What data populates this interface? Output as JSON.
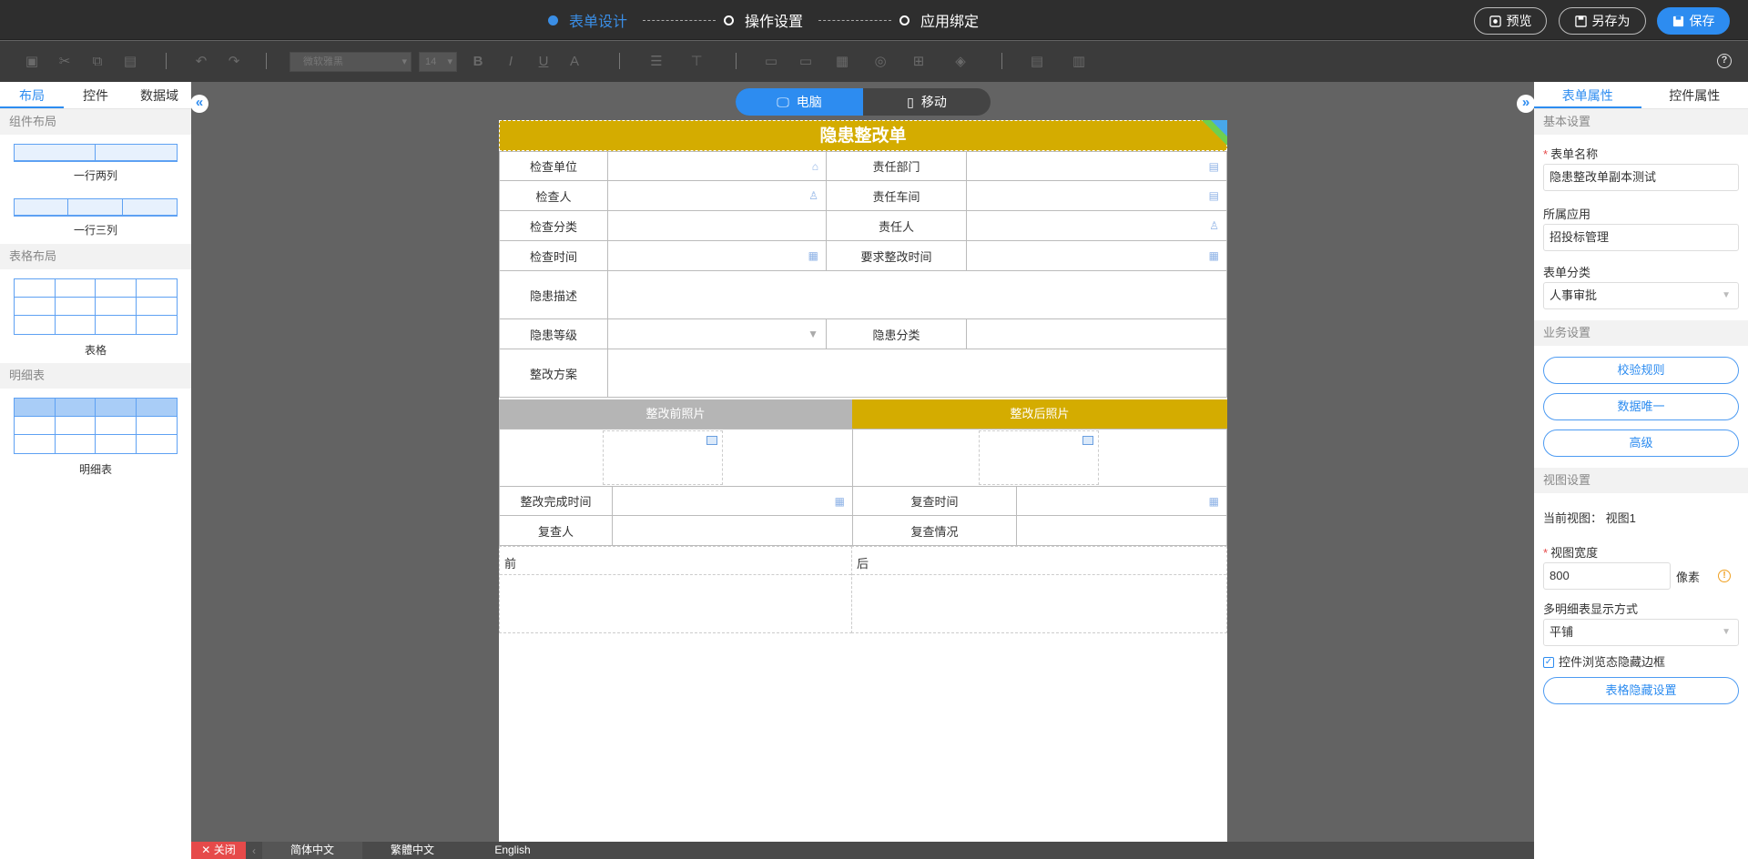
{
  "steps": [
    "表单设计",
    "操作设置",
    "应用绑定"
  ],
  "top_buttons": {
    "preview": "预览",
    "save_as": "另存为",
    "save": "保存"
  },
  "toolbar": {
    "font_name": "微软雅黑",
    "font_size": "14"
  },
  "left_panel": {
    "tabs": [
      "布局",
      "控件",
      "数据域"
    ],
    "sections": {
      "component_layout": "组件布局",
      "table_layout": "表格布局",
      "detail_table": "明细表"
    },
    "items": {
      "two_cols": "一行两列",
      "three_cols": "一行三列",
      "table": "表格",
      "detail": "明细表"
    }
  },
  "device": {
    "pc": "电脑",
    "mobile": "移动"
  },
  "form": {
    "title": "隐患整改单",
    "fields": {
      "check_unit": "检查单位",
      "resp_dept": "责任部门",
      "inspector": "检查人",
      "resp_workshop": "责任车间",
      "check_category": "检查分类",
      "resp_person": "责任人",
      "check_time": "检查时间",
      "req_fix_time": "要求整改时间",
      "hazard_desc": "隐患描述",
      "hazard_level": "隐患等级",
      "hazard_category": "隐患分类",
      "fix_plan": "整改方案",
      "photo_before": "整改前照片",
      "photo_after": "整改后照片",
      "fix_done_time": "整改完成时间",
      "recheck_time": "复查时间",
      "rechecker": "复查人",
      "recheck_status": "复查情况",
      "before": "前",
      "after": "后"
    }
  },
  "languages": {
    "close": "关闭",
    "tabs": [
      "简体中文",
      "繁體中文",
      "English"
    ]
  },
  "right_panel": {
    "tabs": [
      "表单属性",
      "控件属性"
    ],
    "basic_settings": "基本设置",
    "form_name_label": "表单名称",
    "form_name_value": "隐患整改单副本测试",
    "app_label": "所属应用",
    "app_value": "招投标管理",
    "category_label": "表单分类",
    "category_value": "人事审批",
    "business_settings": "业务设置",
    "buttons": [
      "校验规则",
      "数据唯一",
      "高级"
    ],
    "view_settings": "视图设置",
    "current_view_label": "当前视图：",
    "current_view_value": "视图1",
    "view_width_label": "视图宽度",
    "view_width_value": "800",
    "view_width_unit": "像素",
    "multi_detail_label": "多明细表显示方式",
    "multi_detail_value": "平铺",
    "hide_border_label": "控件浏览态隐藏边框",
    "table_hide_btn": "表格隐藏设置"
  },
  "colors": {
    "accent": "#2d8cf0",
    "title_bar": "#d4ac00",
    "photo_before_bg": "#b5b5b5"
  }
}
